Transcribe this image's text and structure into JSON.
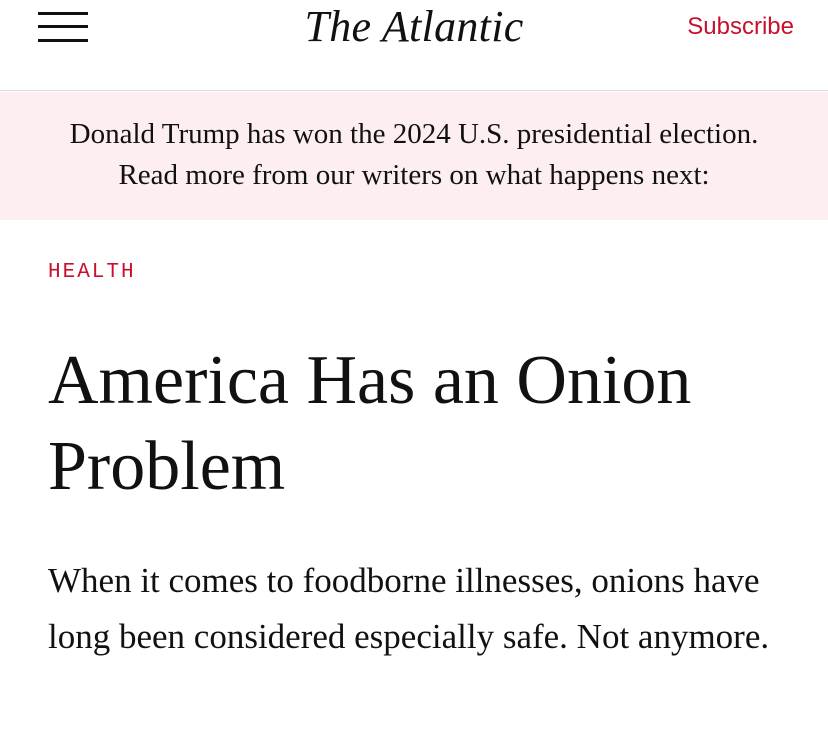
{
  "header": {
    "menu_icon": "hamburger-menu-icon",
    "logo": "The Atlantic",
    "subscribe_label": "Subscribe"
  },
  "banner": {
    "line1": "Donald Trump has won the 2024 U.S. presidential election.",
    "line2": "Read more from our writers on what happens next:"
  },
  "article": {
    "section": "HEALTH",
    "headline": "America Has an Onion Problem",
    "dek": "When it comes to foodborne illnesses, onions have long been considered especially safe. Not anymore."
  },
  "colors": {
    "accent": "#c8102e",
    "banner_bg": "#fdeff0",
    "text": "#111111"
  }
}
